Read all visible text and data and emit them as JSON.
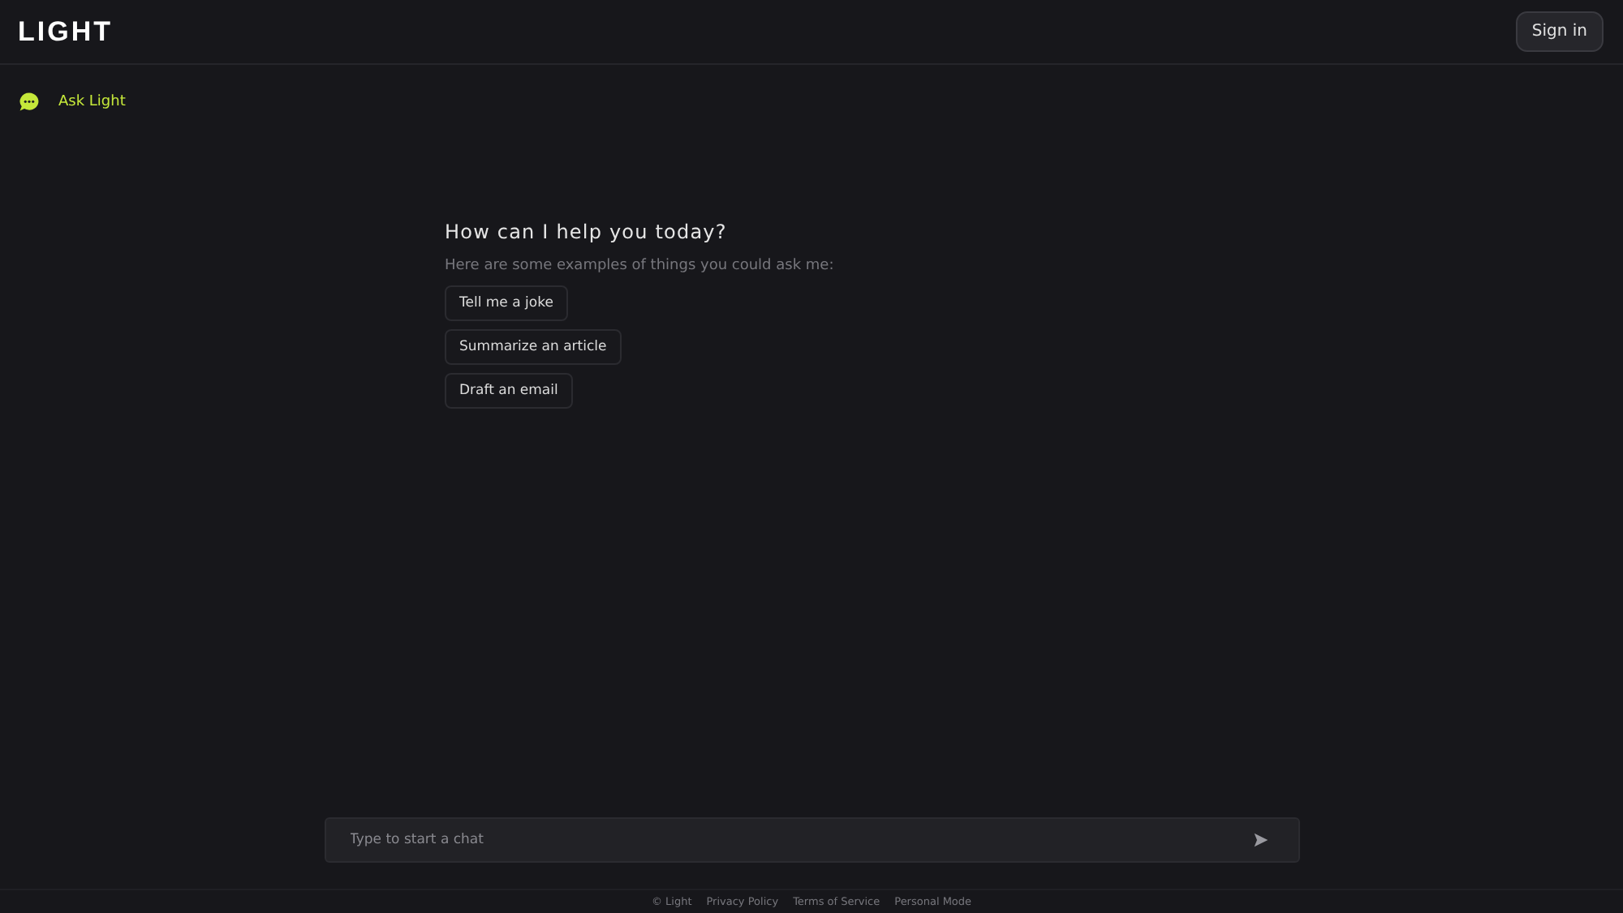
{
  "header": {
    "logo": "LIGHT",
    "sign_in": "Sign in"
  },
  "sidebar": {
    "items": [
      {
        "label": "Ask Light",
        "selected": true
      }
    ]
  },
  "main": {
    "heading": "How can I help you today?",
    "subheading": "Here are some examples of things you could ask me:",
    "suggestions": [
      "Tell me a joke",
      "Summarize an article",
      "Draft an email"
    ]
  },
  "composer": {
    "placeholder": "Type to start a chat"
  },
  "footer": {
    "links": [
      "© Light",
      "Privacy Policy",
      "Terms of Service",
      "Personal Mode"
    ]
  }
}
